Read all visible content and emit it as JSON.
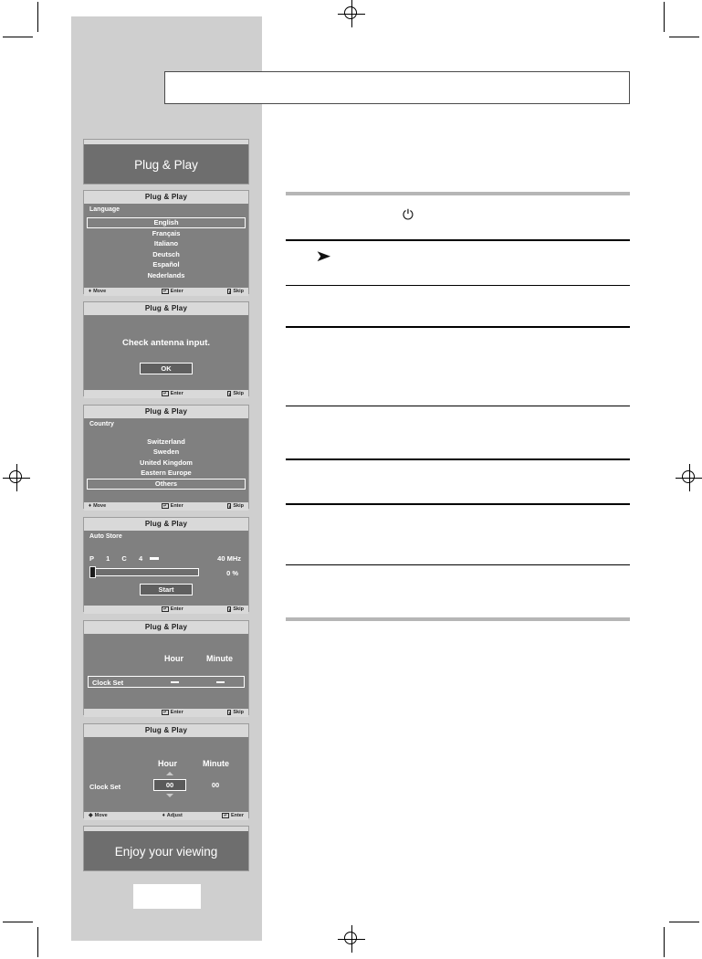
{
  "page": {
    "background": "#ffffff",
    "band_color": "#cfcfcf",
    "osd_body_color": "#808080",
    "osd_header_color": "#d9d9d9",
    "banner_color": "#6e6e6e",
    "rule_color": "#000000",
    "thick_rule_color": "#b6b6b6"
  },
  "title_box": {
    "text": ""
  },
  "right_table": {
    "rows": [
      {
        "glyph": "power-icon",
        "glyph_char": "⏻",
        "text": ""
      },
      {
        "glyph": "arrow-pointer-icon",
        "glyph_char": "➤",
        "text": ""
      },
      {
        "glyph": "",
        "glyph_char": "",
        "text": ""
      },
      {
        "glyph": "",
        "glyph_char": "",
        "text": ""
      },
      {
        "glyph": "",
        "glyph_char": "",
        "text": ""
      },
      {
        "glyph": "",
        "glyph_char": "",
        "text": ""
      },
      {
        "glyph": "",
        "glyph_char": "",
        "text": ""
      },
      {
        "glyph": "",
        "glyph_char": "",
        "text": ""
      }
    ]
  },
  "osd": {
    "title": "Plug & Play",
    "splash": {
      "text": "Plug & Play"
    },
    "language": {
      "title": "Plug & Play",
      "section_label": "Language",
      "options": [
        "English",
        "Français",
        "Italiano",
        "Deutsch",
        "Español",
        "Nederlands"
      ],
      "selected": "English",
      "footer": {
        "move": "Move",
        "enter": "Enter",
        "skip": "Skip"
      }
    },
    "antenna": {
      "title": "Plug & Play",
      "message": "Check antenna input.",
      "button": "OK",
      "footer": {
        "move": "",
        "enter": "Enter",
        "skip": "Skip"
      }
    },
    "country": {
      "title": "Plug & Play",
      "section_label": "Country",
      "options": [
        "Switzerland",
        "Sweden",
        "United Kingdom",
        "Eastern Europe",
        "Others"
      ],
      "selected": "Others",
      "footer": {
        "move": "Move",
        "enter": "Enter",
        "skip": "Skip"
      }
    },
    "auto_store": {
      "title": "Plug & Play",
      "section_label": "Auto Store",
      "prog_label": "P",
      "prog_value": "1",
      "chan_label": "C",
      "chan_value": "4",
      "frequency": "40 MHz",
      "percent": "0 %",
      "progress": 0,
      "button": "Start",
      "footer": {
        "move": "",
        "enter": "Enter",
        "skip": "Skip"
      }
    },
    "clock_empty": {
      "title": "Plug & Play",
      "hour_header": "Hour",
      "minute_header": "Minute",
      "row_label": "Clock Set",
      "hour_value": "—",
      "minute_value": "—",
      "footer": {
        "move": "",
        "enter": "Enter",
        "skip": "Skip"
      }
    },
    "clock_set": {
      "title": "Plug & Play",
      "hour_header": "Hour",
      "minute_header": "Minute",
      "row_label": "Clock Set",
      "hour_value": "00",
      "minute_value": "00",
      "footer": {
        "move": "Move",
        "adjust": "Adjust",
        "enter": "Enter"
      }
    },
    "enjoy": {
      "text": "Enjoy your viewing"
    }
  }
}
